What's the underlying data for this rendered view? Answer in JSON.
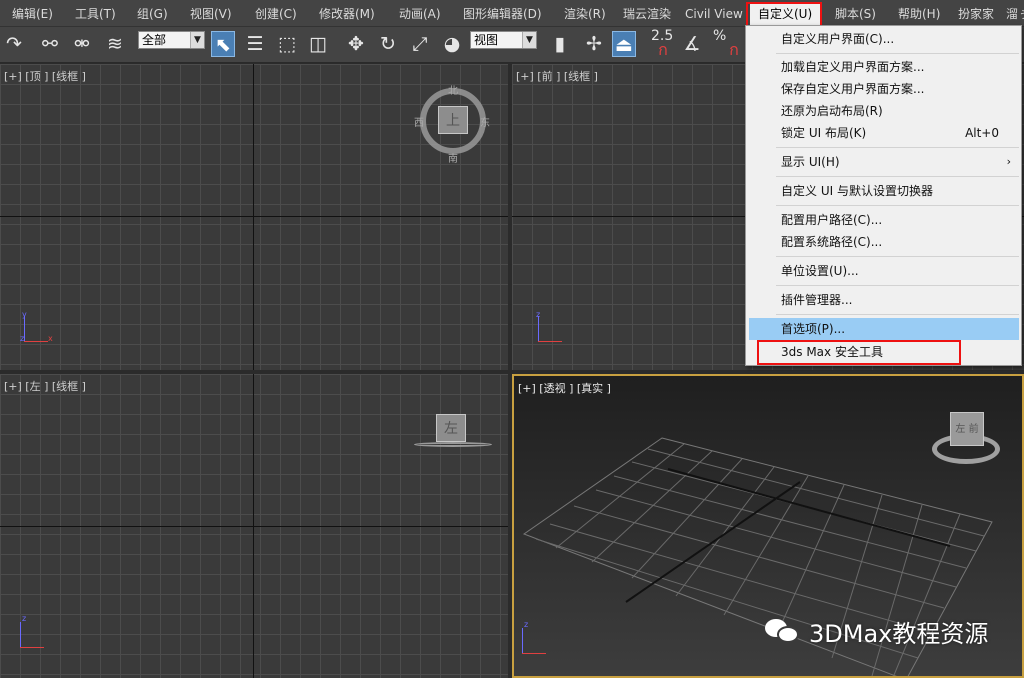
{
  "menubar": {
    "items": [
      "编辑(E)",
      "工具(T)",
      "组(G)",
      "视图(V)",
      "创建(C)",
      "修改器(M)",
      "动画(A)",
      "图形编辑器(D)",
      "渲染(R)",
      "瑞云渲染",
      "Civil View",
      "自定义(U)",
      "脚本(S)",
      "帮助(H)",
      "扮家家",
      "溜ぅ"
    ]
  },
  "toolbar": {
    "selection_filter": "全部",
    "reference_coord": "视图",
    "snap_value": "2.5",
    "percent_symbol": "%"
  },
  "viewports": {
    "top": {
      "label": "[+] [顶 ] [线框 ]",
      "compass": {
        "n": "北",
        "s": "南",
        "e": "东",
        "w": "西"
      },
      "cube_face": "上"
    },
    "front": {
      "label": "[+] [前 ] [线框 ]"
    },
    "left": {
      "label": "[+] [左 ] [线框 ]",
      "cube_face": "左"
    },
    "perspective": {
      "label": "[+] [透视 ] [真实 ]",
      "cube_face": "左 前"
    }
  },
  "customize_menu": {
    "items": [
      {
        "label": "自定义用户界面(C)..."
      },
      {
        "label": "加载自定义用户界面方案..."
      },
      {
        "label": "保存自定义用户界面方案..."
      },
      {
        "label": "还原为启动布局(R)"
      },
      {
        "label": "锁定 UI 布局(K)",
        "shortcut": "Alt+0"
      },
      {
        "label": "显示 UI(H)",
        "submenu": "›"
      },
      {
        "label": "自定义 UI 与默认设置切换器"
      },
      {
        "label": "配置用户路径(C)..."
      },
      {
        "label": "配置系统路径(C)..."
      },
      {
        "label": "单位设置(U)..."
      },
      {
        "label": "插件管理器..."
      },
      {
        "label": "首选项(P)..."
      },
      {
        "label": "3ds Max 安全工具"
      }
    ]
  },
  "watermark": {
    "text": "3DMax教程资源"
  },
  "colors": {
    "highlight": "#99ccf4",
    "annotation_red": "#e11111",
    "active_viewport_border": "#c8a040"
  }
}
